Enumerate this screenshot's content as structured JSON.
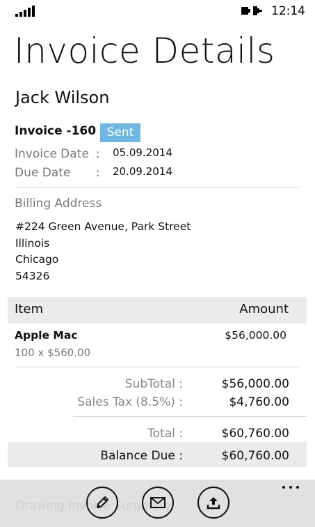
{
  "status_bar": {
    "time": "12:14",
    "signal_icon": "signal-bars-icon",
    "battery_icon": "battery-charging-icon"
  },
  "page": {
    "title": "Invoice Details",
    "customer_name": "Jack Wilson"
  },
  "invoice": {
    "number_label": "Invoice -160",
    "status": "Sent",
    "status_color": "#6fb6e3",
    "date_label": "Invoice Date",
    "date_value": "05.09.2014",
    "due_label": "Due Date",
    "due_value": "20.09.2014",
    "colon": ":"
  },
  "billing": {
    "label": "Billing Address",
    "lines": [
      "#224 Green Avenue, Park Street",
      "Illinois",
      "Chicago",
      "54326"
    ]
  },
  "items": {
    "header_item": "Item",
    "header_amount": "Amount",
    "rows": [
      {
        "name": "Apple Mac",
        "qty_price": "100 x $560.00",
        "amount": "$56,000.00"
      }
    ]
  },
  "totals": {
    "subtotal_label": "SubTotal :",
    "subtotal_value": "$56,000.00",
    "tax_label": "Sales Tax (8.5%) :",
    "tax_value": "$4,760.00",
    "total_label": "Total :",
    "total_value": "$60,760.00",
    "balance_label": "Balance Due :",
    "balance_value": "$60,760.00"
  },
  "app_bar": {
    "buttons": [
      {
        "icon": "edit-pencil-icon"
      },
      {
        "icon": "mail-icon"
      },
      {
        "icon": "upload-icon"
      }
    ],
    "more_icon": "ellipsis-icon",
    "ghost_text": "Drawing Invoice Summary"
  }
}
